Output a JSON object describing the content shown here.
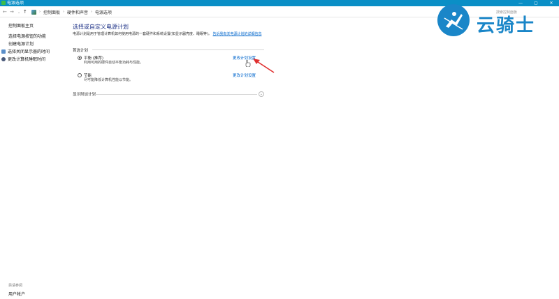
{
  "window": {
    "title": "电源选项",
    "minimize_icon": "—",
    "maximize_icon": "▢",
    "close_icon": "✕"
  },
  "address": {
    "back_icon": "←",
    "forward_icon": "→",
    "recent_icon": "⌄",
    "up_icon": "↑",
    "crumbs": [
      "控制面板",
      "硬件和声音",
      "电源选项"
    ],
    "search_placeholder": "搜索控制面板"
  },
  "watermark": {
    "brand": "云骑士"
  },
  "sidebar": {
    "home": "控制面板主页",
    "items": [
      "选择电源按钮的功能",
      "创建电源计划",
      "选择关闭显示器的时间",
      "更改计算机睡眠时间"
    ],
    "see_also": "另请参阅",
    "user_accounts": "用户帐户"
  },
  "main": {
    "title": "选择或自定义电源计划",
    "description": "电源计划是用于管理计算机如何使用电源的一套硬件和系统设置(如显示器亮度、睡眠等)。",
    "description_link": "告诉我有关电源计划的详细信息",
    "section_label": "首选计划",
    "plans": [
      {
        "name": "平衡 (推荐)",
        "desc": "利用可用的硬件自动平衡功耗与性能。",
        "link": "更改计划设置",
        "selected": true
      },
      {
        "name": "节能",
        "desc": "尽可能降低计算机性能以节能。",
        "link": "更改计划设置",
        "selected": false
      }
    ],
    "extra_plans_label": "显示附加计划",
    "extra_toggle_icon": "⌄"
  },
  "colors": {
    "titlebar": "#0a8fc6",
    "link": "#0066cc",
    "heading": "#1e3287",
    "annotation_arrow": "#e03030"
  }
}
